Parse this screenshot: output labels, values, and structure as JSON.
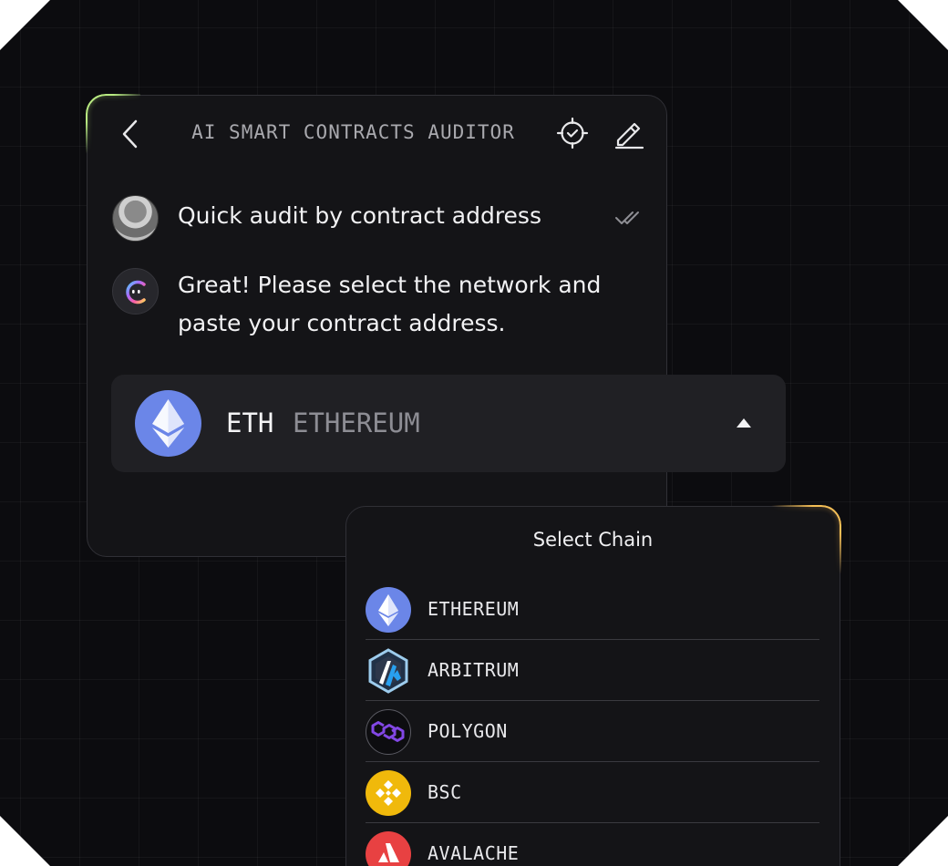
{
  "header": {
    "title": "AI SMART CONTRACTS AUDITOR",
    "back_icon": "chevron-left-icon",
    "target_icon": "target-check-icon",
    "edit_icon": "pencil-icon"
  },
  "messages": {
    "user": "Quick audit by contract address",
    "bot": "Great! Please select the network and paste your contract address."
  },
  "selected_chain": {
    "symbol": "ETH",
    "name": "ETHEREUM",
    "icon": "ethereum-icon",
    "caret_icon": "caret-up-icon"
  },
  "dropdown": {
    "title": "Select Chain",
    "items": [
      {
        "label": "ETHEREUM",
        "icon": "ethereum-icon",
        "color": "#6b86e8"
      },
      {
        "label": "ARBITRUM",
        "icon": "arbitrum-icon",
        "color": "#213147"
      },
      {
        "label": "POLYGON",
        "icon": "polygon-icon",
        "color": "#8247e5"
      },
      {
        "label": "BSC",
        "icon": "bnb-icon",
        "color": "#f0b90b"
      },
      {
        "label": "AVALACHE",
        "icon": "avalanche-icon",
        "color": "#e84142"
      }
    ]
  },
  "colors": {
    "background": "#0c0c0f",
    "panel": "#141417",
    "select_bg": "#202024",
    "glow_green": "#c8ff8c",
    "glow_orange": "#ffc85a"
  }
}
